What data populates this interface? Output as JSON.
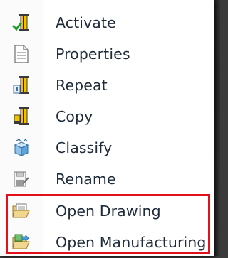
{
  "context_menu": {
    "items": [
      {
        "label": "Activate",
        "icon": "activate-icon"
      },
      {
        "label": "Properties",
        "icon": "properties-icon"
      },
      {
        "label": "Repeat",
        "icon": "repeat-icon"
      },
      {
        "label": "Copy",
        "icon": "copy-icon"
      },
      {
        "label": "Classify",
        "icon": "classify-icon"
      },
      {
        "label": "Rename",
        "icon": "rename-icon"
      },
      {
        "label": "Open Drawing",
        "icon": "open-drawing-icon"
      },
      {
        "label": "Open Manufacturing",
        "icon": "open-manufacturing-icon"
      }
    ],
    "highlighted_items": [
      "Open Drawing",
      "Open Manufacturing"
    ],
    "highlight_color": "#e3101a",
    "text_color": "#1f2b3a"
  }
}
